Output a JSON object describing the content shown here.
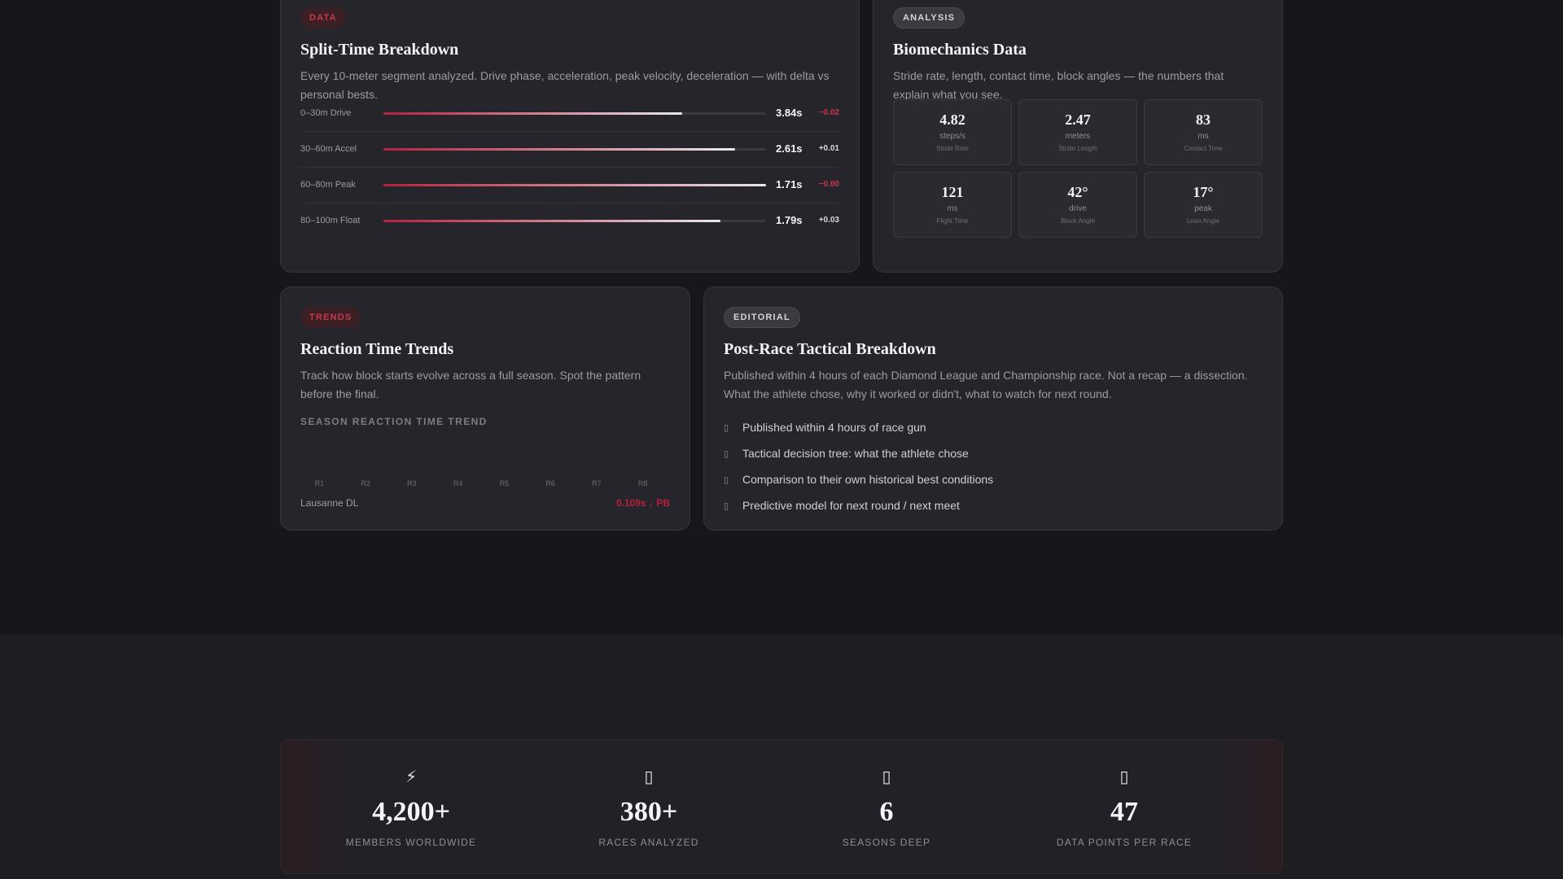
{
  "split_card": {
    "tag": "DATA",
    "title": "Split-Time Breakdown",
    "description": "Every 10-meter segment analyzed. Drive phase, acceleration, peak velocity, deceleration — with delta vs personal bests.",
    "rows": [
      {
        "label": "0–30m Drive",
        "progress": 0.78,
        "time": "3.84s",
        "delta": "−0.02",
        "delta_type": "neg"
      },
      {
        "label": "30–60m Accel",
        "progress": 0.92,
        "time": "2.61s",
        "delta": "+0.01",
        "delta_type": "pos"
      },
      {
        "label": "60–80m Peak",
        "progress": 1.0,
        "time": "1.71s",
        "delta": "−0.00",
        "delta_type": "neg"
      },
      {
        "label": "80–100m Float",
        "progress": 0.88,
        "time": "1.79s",
        "delta": "+0.03",
        "delta_type": "pos"
      }
    ]
  },
  "bio_card": {
    "tag": "ANALYSIS",
    "title": "Biomechanics Data",
    "description": "Stride rate, length, contact time, block angles — the numbers that explain what you see.",
    "cells": [
      {
        "value": "4.82",
        "unit": "steps/s",
        "label": "Stride Rate"
      },
      {
        "value": "2.47",
        "unit": "meters",
        "label": "Stride Length"
      },
      {
        "value": "83",
        "unit": "ms",
        "label": "Contact Time"
      },
      {
        "value": "121",
        "unit": "ms",
        "label": "Flight Time"
      },
      {
        "value": "42°",
        "unit": "drive",
        "label": "Block Angle"
      },
      {
        "value": "17°",
        "unit": "peak",
        "label": "Lean Angle"
      }
    ]
  },
  "trend_card": {
    "tag": "TRENDS",
    "title": "Reaction Time Trends",
    "description": "Track how block starts evolve across a full season. Spot the pattern before the final.",
    "chart_heading": "SEASON REACTION TIME TREND",
    "footer_left": "Lausanne DL",
    "footer_right": "0.109s ↓ PB"
  },
  "chart_data": {
    "type": "bar",
    "title": "SEASON REACTION TIME TREND",
    "categories": [
      "R1",
      "R2",
      "R3",
      "R4",
      "R5",
      "R6",
      "R7",
      "R8"
    ],
    "values": [],
    "xlabel": "",
    "ylabel": ""
  },
  "editorial_card": {
    "tag": "EDITORIAL",
    "title": "Post-Race Tactical Breakdown",
    "description": "Published within 4 hours of each Diamond League and Championship race. Not a recap — a dissection. What the athlete chose, why it worked or didn't, what to watch for next round.",
    "items": [
      {
        "text": "Published within 4 hours of race gun",
        "icon": "clock-icon"
      },
      {
        "text": "Tactical decision tree: what the athlete chose",
        "icon": "tree-icon"
      },
      {
        "text": "Comparison to their own historical best conditions",
        "icon": "chart-icon"
      },
      {
        "text": "Predictive model for next round / next meet",
        "icon": "target-icon"
      }
    ]
  },
  "stats": [
    {
      "icon": "lightning-icon",
      "glyph": "⚡",
      "value": "4,200+",
      "label": "MEMBERS WORLDWIDE"
    },
    {
      "icon": "races-icon",
      "glyph": "▯",
      "value": "380+",
      "label": "RACES ANALYZED"
    },
    {
      "icon": "calendar-icon",
      "glyph": "▯",
      "value": "6",
      "label": "SEASONS DEEP"
    },
    {
      "icon": "data-icon",
      "glyph": "▯",
      "value": "47",
      "label": "DATA POINTS PER RACE"
    }
  ],
  "colors": {
    "accent": "#b4223a",
    "card": "#26252b",
    "background": "#17161b"
  }
}
